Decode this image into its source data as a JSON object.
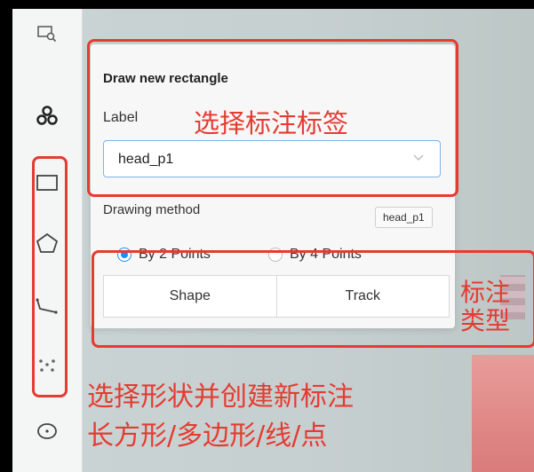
{
  "panel": {
    "title": "Draw new rectangle",
    "label_caption": "Label",
    "label_value": "head_p1",
    "drawing_method_caption": "Drawing method",
    "tag": "head_p1",
    "radio_options": [
      {
        "label": "By 2 Points",
        "selected": true
      },
      {
        "label": "By 4 Points",
        "selected": false
      }
    ],
    "buttons": {
      "shape": "Shape",
      "track": "Track"
    }
  },
  "sidebar": {
    "tools": [
      "zoom-region-icon",
      "tag-cluster-icon",
      "rectangle-icon",
      "polygon-icon",
      "polyline-icon",
      "points-icon",
      "ellipse-icon"
    ]
  },
  "annotations": {
    "label_note": "选择标注标签",
    "type_note_line1": "标注",
    "type_note_line2": "类型",
    "shape_note_line1": "选择形状并创建新标注",
    "shape_note_line2": "长方形/多边形/线/点"
  },
  "colors": {
    "annotation_red": "#e53b32",
    "accent_blue": "#1890ff"
  }
}
